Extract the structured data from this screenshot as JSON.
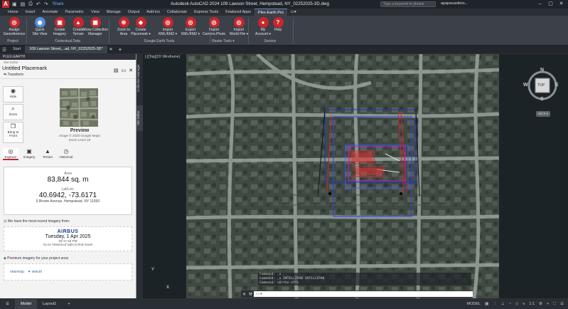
{
  "titlebar": {
    "app_letter": "A",
    "share": "Share",
    "title": "Autodesk AutoCAD 2024   109 Lawson Street, Hempstead, NY_02252025-3D.dwg",
    "search_placeholder": "Type a keyword or phrase",
    "user": "apapavasileio...",
    "accent": "#c8262c"
  },
  "tabs": [
    "Home",
    "Insert",
    "Annotate",
    "Parametric",
    "View",
    "Manage",
    "Output",
    "Add-ins",
    "Collaborate",
    "Express Tools",
    "Featured Apps",
    "Plex-Earth Pro",
    "▭▾"
  ],
  "active_tab": "Plex-Earth Pro",
  "ribbon": {
    "buttons": [
      {
        "label": "Assign\nGeoreference",
        "icon": "globe-pin-icon",
        "glyph": "◎",
        "color": "#c8262c"
      },
      {
        "label": "Quick\nSite View",
        "icon": "binoculars-icon",
        "glyph": "◉",
        "color": "#4f8fd8"
      },
      {
        "label": "Create\nImagery",
        "icon": "imagery-icon",
        "glyph": "▣",
        "color": "#c8262c"
      },
      {
        "label": "Create\nTerrain",
        "icon": "terrain-icon",
        "glyph": "▲",
        "color": "#c8262c"
      },
      {
        "label": "Show Collection\nManager",
        "icon": "collection-icon",
        "glyph": "▦",
        "color": "#c8262c"
      },
      {
        "label": "Zoom to\nArea",
        "icon": "zoom-area-icon",
        "glyph": "⊕",
        "color": "#c8262c"
      },
      {
        "label": "Create\nPlacemark ▾",
        "icon": "placemark-icon",
        "glyph": "◆",
        "color": "#c8262c"
      },
      {
        "label": "Import\nKML/KMZ ▾",
        "icon": "import-kml-icon",
        "glyph": "◎",
        "color": "#c8262c"
      },
      {
        "label": "Export\nKML/KMZ ▾",
        "icon": "export-kml-icon",
        "glyph": "◎",
        "color": "#c8262c"
      },
      {
        "label": "Import\nCamera Photo",
        "icon": "camera-photo-icon",
        "glyph": "◎",
        "color": "#c8262c"
      },
      {
        "label": "Import\nWorld File ▾",
        "icon": "world-file-icon",
        "glyph": "◎",
        "color": "#c8262c"
      },
      {
        "label": "My\nAccount ▾",
        "icon": "account-icon",
        "glyph": "●",
        "color": "#c8262c"
      },
      {
        "label": "Help",
        "icon": "help-icon",
        "glyph": "?",
        "color": "#c8262c"
      }
    ],
    "groups": [
      "Project",
      "Contextual Data",
      "Google Earth Tools",
      "Raster Tools ▾",
      "Service"
    ]
  },
  "filetabs": {
    "start": "Start",
    "file": "109 Lawson Street,...ad, NY_02252025-3D*"
  },
  "panel": {
    "header": "PLEX-EARTH",
    "edit_label": "Site Editor",
    "place_name": "Untitled Placemark",
    "transform": "Transform",
    "side_buttons": [
      {
        "label": "Hide",
        "glyph": "◉"
      },
      {
        "label": "Zoom",
        "glyph": "⌕"
      },
      {
        "label": "Bring to\nFront",
        "glyph": "❐"
      }
    ],
    "preview_title": "Preview",
    "preview_credit": "Image © 2025 Google Maps",
    "preview_zoom": "Zoom Level 19",
    "nav_tabs": [
      {
        "label": "Explorer",
        "glyph": "◎"
      },
      {
        "label": "Imagery",
        "glyph": "▣"
      },
      {
        "label": "Terrain",
        "glyph": "▲"
      },
      {
        "label": "Historical",
        "glyph": "◷"
      }
    ],
    "area_label": "Area",
    "area_value": "83,844 sq. m",
    "latlon_label": "Lat/Lon:",
    "latlon_value": "40.6942, -73.6171",
    "address": "6 Brown Avenue, Hempstead, NY 11550",
    "recent_note": "We have the most recent imagery from:",
    "provider": "AIRBUS",
    "imagery_date": "Tuesday, 1 Apr 2025",
    "imagery_time": "03:17:16 PM",
    "historical_hint": "Go to 'Historical' tabs to find more!",
    "premium_note": "Premium imagery for your project area:",
    "premium_logos": [
      "nearmap",
      "✦ vexcel"
    ]
  },
  "sidetabs": [
    "Collection Manager",
    "Site Editor"
  ],
  "viewport": {
    "control": "[-][Top][2D Wireframe]",
    "cube": {
      "n": "N",
      "s": "S",
      "e": "E",
      "w": "W",
      "top": "TOP",
      "wcs": "WCS ▾"
    },
    "ucs": {
      "x": "X",
      "y": "Y"
    },
    "cmd_lines": [
      "Command: _u",
      "Command: _u INTELLIPAN INTELLIPAN",
      "Command: <Ortho off>"
    ],
    "cmd_placeholder": "▭ ▾"
  },
  "status": {
    "model": "Model",
    "layout": "Layout1",
    "model_right": "MODEL",
    "scale": "1:1"
  }
}
